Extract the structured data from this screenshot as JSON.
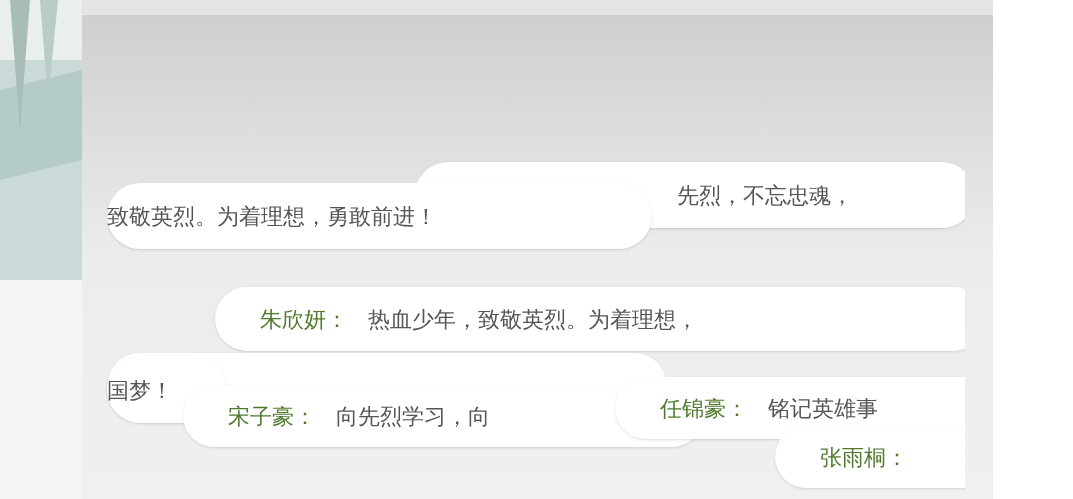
{
  "bubbles": [
    {
      "message": "先烈，不忘忠魂，"
    },
    {
      "message": "致敬英烈。为着理想，勇敢前进！"
    },
    {
      "name": "朱欣妍：",
      "message": "热血少年，致敬英烈。为着理想，"
    },
    {
      "message": "国梦！"
    },
    {
      "name": "宋子豪：",
      "message": "向先烈学习，向"
    },
    {
      "name": "任锦豪：",
      "message": "铭记英雄事"
    },
    {
      "name": "张雨桐："
    }
  ]
}
